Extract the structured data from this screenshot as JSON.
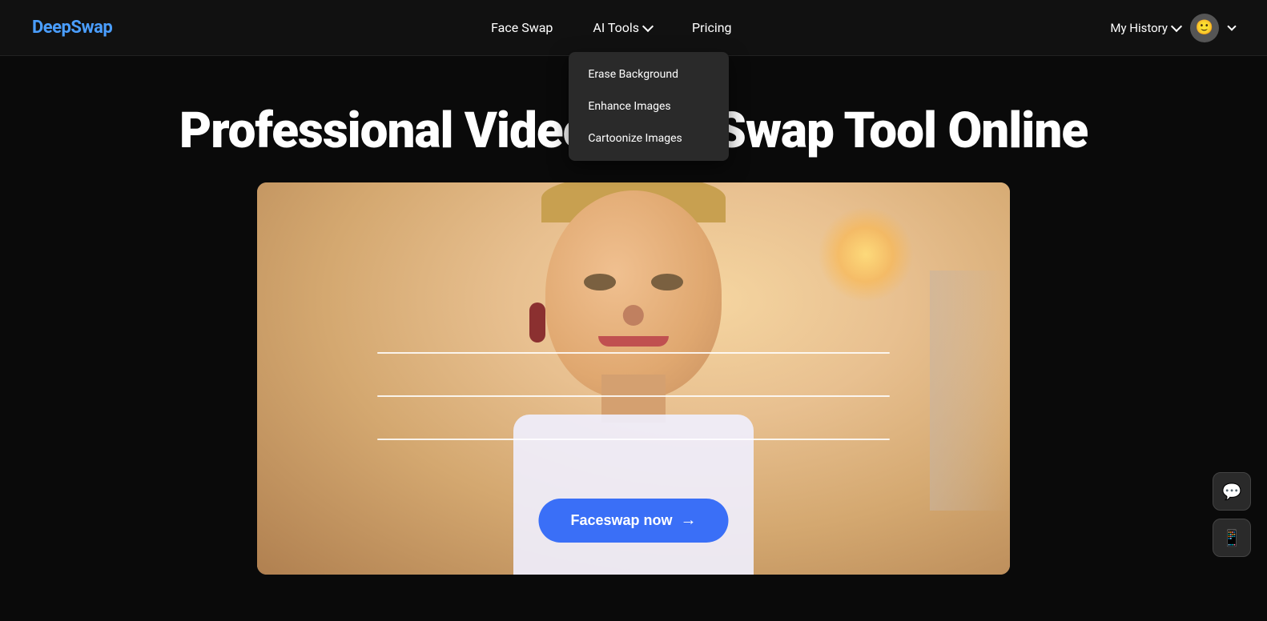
{
  "logo": {
    "text": "DeepSwap"
  },
  "navbar": {
    "face_swap_label": "Face Swap",
    "ai_tools_label": "AI Tools",
    "pricing_label": "Pricing",
    "my_history_label": "My History"
  },
  "dropdown": {
    "items": [
      {
        "label": "Erase Background",
        "id": "erase-background"
      },
      {
        "label": "Enhance Images",
        "id": "enhance-images"
      },
      {
        "label": "Cartoonize Images",
        "id": "cartoonize-images"
      }
    ]
  },
  "hero": {
    "title": "Professional Video Face Swap Tool Online"
  },
  "cta": {
    "button_label": "Faceswap now",
    "arrow": "→"
  },
  "floating": {
    "chat_icon": "💬",
    "app_icon": "📱"
  }
}
